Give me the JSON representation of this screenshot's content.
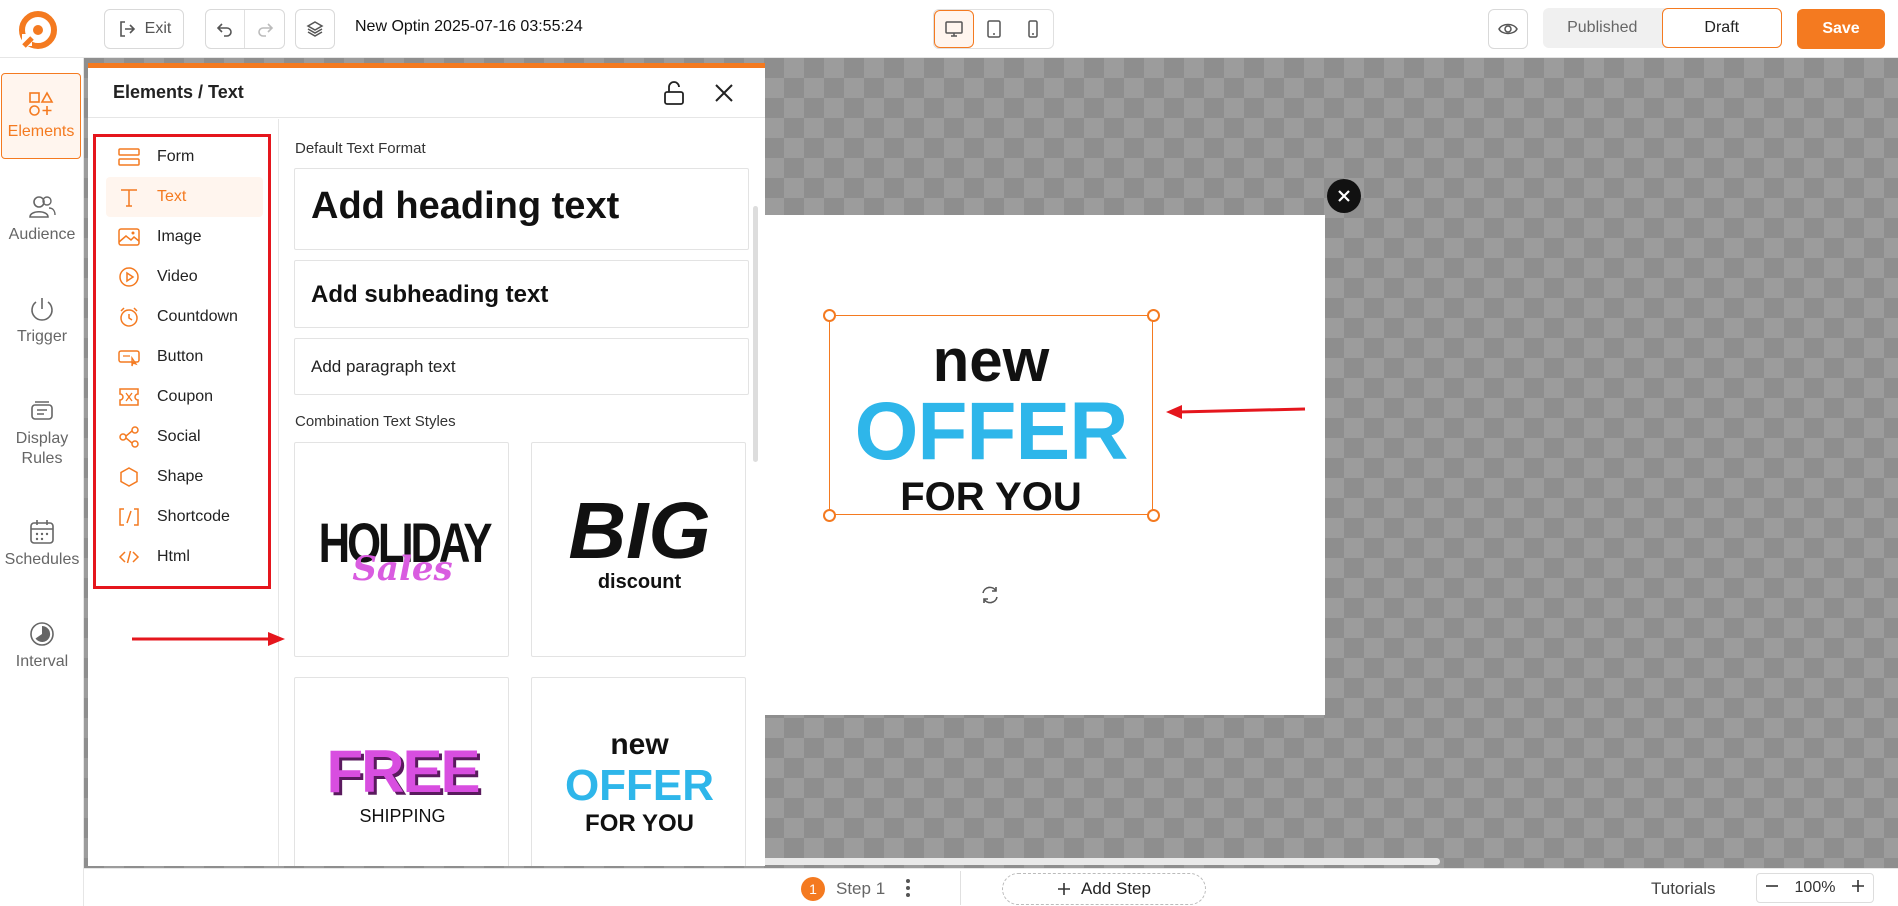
{
  "header": {
    "exit_label": "Exit",
    "doc_title": "New Optin 2025-07-16 03:55:24",
    "devices": [
      "desktop",
      "tablet",
      "mobile"
    ],
    "active_device": "desktop",
    "status_options": [
      "Published",
      "Draft"
    ],
    "active_status": "Draft",
    "save_label": "Save"
  },
  "leftnav": {
    "items": [
      {
        "label": "Elements",
        "icon": "elements-icon",
        "active": true
      },
      {
        "label": "Audience",
        "icon": "audience-icon"
      },
      {
        "label": "Trigger",
        "icon": "power-icon"
      },
      {
        "label": "Display Rules",
        "label_lines": [
          "Display",
          "Rules"
        ],
        "icon": "display-rules-icon"
      },
      {
        "label": "Schedules",
        "icon": "calendar-icon"
      },
      {
        "label": "Interval",
        "icon": "interval-icon"
      }
    ]
  },
  "panel": {
    "title": "Elements / Text",
    "elements": [
      {
        "label": "Form",
        "icon": "form-icon"
      },
      {
        "label": "Text",
        "icon": "text-icon",
        "active": true
      },
      {
        "label": "Image",
        "icon": "image-icon"
      },
      {
        "label": "Video",
        "icon": "video-icon"
      },
      {
        "label": "Countdown",
        "icon": "countdown-icon"
      },
      {
        "label": "Button",
        "icon": "button-icon"
      },
      {
        "label": "Coupon",
        "icon": "coupon-icon"
      },
      {
        "label": "Social",
        "icon": "social-icon"
      },
      {
        "label": "Shape",
        "icon": "shape-icon"
      },
      {
        "label": "Shortcode",
        "icon": "shortcode-icon"
      },
      {
        "label": "Html",
        "icon": "html-icon"
      }
    ],
    "default_format_label": "Default Text Format",
    "heading_text": "Add heading text",
    "subheading_text": "Add subheading text",
    "paragraph_text": "Add paragraph text",
    "combination_label": "Combination Text Styles",
    "combos": {
      "holiday": {
        "line1": "HOLIDAY",
        "line2": "Sales"
      },
      "big": {
        "line1": "BIG",
        "line2": "discount"
      },
      "free": {
        "line1": "FREE",
        "line2": "SHIPPING"
      },
      "offer": {
        "line1": "new",
        "line2": "OFFER",
        "line3": "FOR YOU"
      }
    }
  },
  "canvas": {
    "text_new": "new",
    "text_offer": "OFFER",
    "text_foryou": "FOR YOU"
  },
  "footer": {
    "step_number": "1",
    "step_label": "Step 1",
    "add_step_label": "Add Step",
    "tutorials_label": "Tutorials",
    "zoom": "100%"
  },
  "colors": {
    "accent": "#f47a20",
    "offer_blue": "#2eb6ea",
    "annotation_red": "#e5161d",
    "holiday_pink": "#d95ce0",
    "free_magenta": "#d84ee0"
  }
}
